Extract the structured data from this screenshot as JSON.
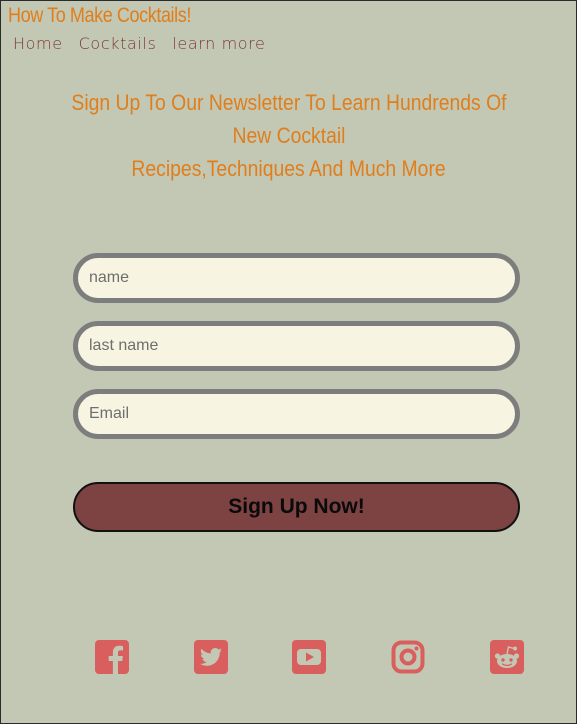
{
  "header": {
    "site_title": "How To Make Cocktails!",
    "nav": [
      {
        "label": "Home"
      },
      {
        "label": "Cocktails"
      },
      {
        "label": "learn more"
      }
    ]
  },
  "main": {
    "headline_line1": "Sign Up To Our Newsletter To Learn Hundrends Of New Cocktail",
    "headline_line2": "Recipes,Techniques And Much More",
    "form": {
      "name_placeholder": "name",
      "lastname_placeholder": "last name",
      "email_placeholder": "Email",
      "submit_label": "Sign Up Now!"
    }
  },
  "footer": {
    "social": [
      {
        "icon": "facebook-icon"
      },
      {
        "icon": "twitter-icon"
      },
      {
        "icon": "youtube-icon"
      },
      {
        "icon": "instagram-icon"
      },
      {
        "icon": "reddit-icon"
      }
    ]
  },
  "colors": {
    "background": "#c3c8b4",
    "accent_orange": "#e07e1c",
    "nav_text": "#7a3a37",
    "button_bg": "#7d4242",
    "input_bg": "#f7f5e1",
    "icon_color": "#d95f5f"
  }
}
